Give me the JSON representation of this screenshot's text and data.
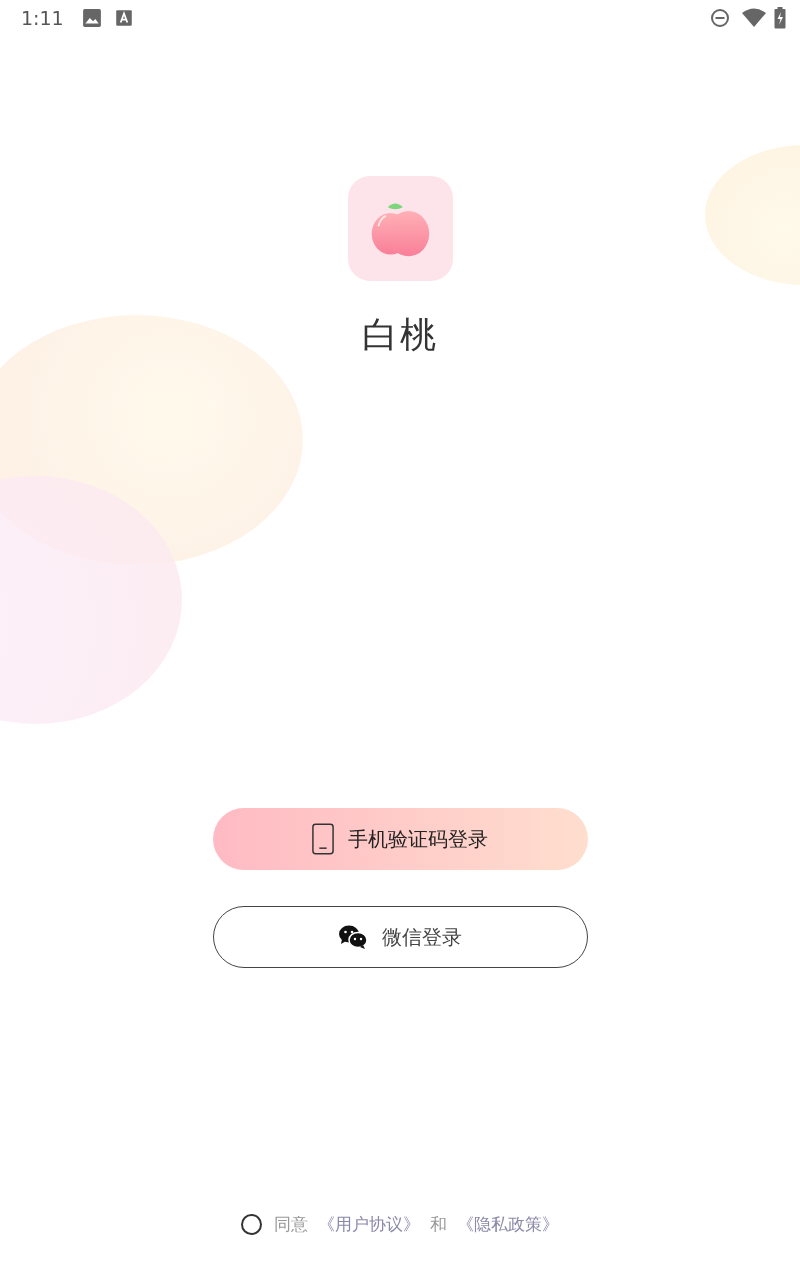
{
  "status_bar": {
    "time": "1:11"
  },
  "app": {
    "name": "白桃"
  },
  "buttons": [
    {
      "kind": "phone",
      "label": "手机验证码登录"
    },
    {
      "kind": "wechat",
      "label": "微信登录"
    }
  ],
  "agreement": {
    "checked": false,
    "prefix": "同意",
    "user_agreement": "《用户协议》",
    "conjunction": "和",
    "privacy_policy": "《隐私政策》"
  }
}
